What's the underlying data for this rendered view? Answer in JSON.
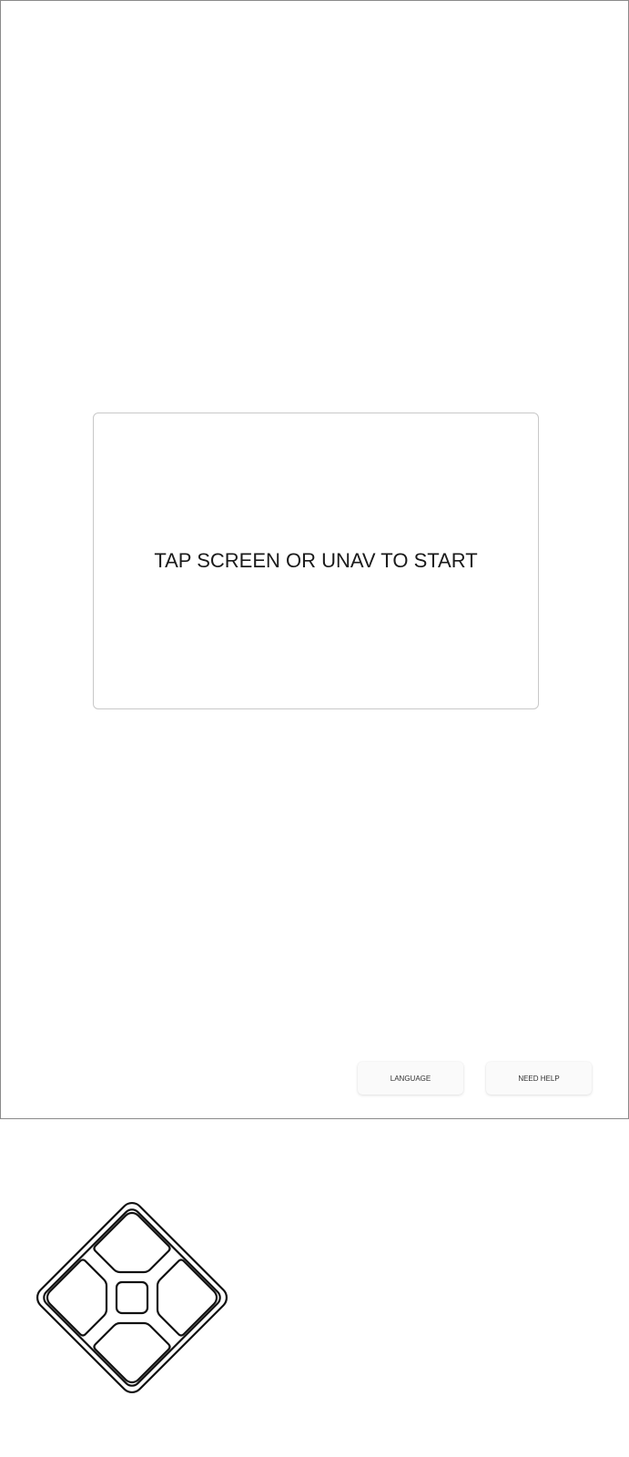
{
  "main": {
    "start_prompt": "TAP SCREEN OR UNAV TO START"
  },
  "footer": {
    "language_label": "LANGUAGE",
    "help_label": "NEED HELP"
  },
  "unav": {
    "icon": "unav-dpad-icon",
    "buttons": [
      "up",
      "left",
      "center",
      "right",
      "down"
    ]
  }
}
